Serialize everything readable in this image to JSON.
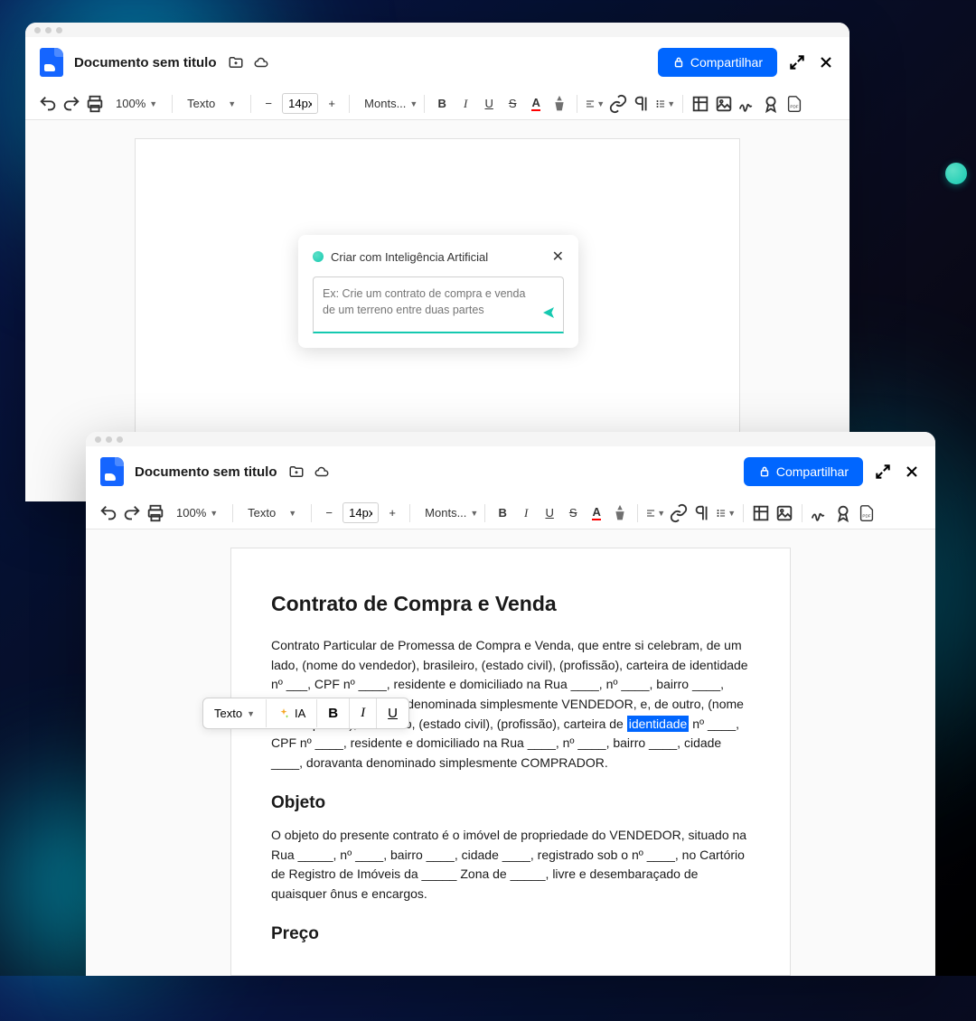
{
  "header": {
    "title": "Documento sem titulo",
    "share_label": "Compartilhar"
  },
  "toolbar": {
    "zoom": "100%",
    "style": "Texto",
    "font_size": "14px",
    "font_family": "Monts..."
  },
  "ai_dialog": {
    "title": "Criar com Inteligência Artificial",
    "placeholder": "Ex: Crie um contrato de compra e venda de um terreno entre duas partes"
  },
  "float_toolbar": {
    "style": "Texto",
    "ai_label": "IA"
  },
  "document": {
    "title": "Contrato de Compra e Venda",
    "para1_a": "Contrato Particular de Promessa de Compra e Venda, que entre si celebram, de um lado, (nome do vendedor), brasileiro, (estado civil), (profissão), carteira de identidade nº ___, CPF nº ____, residente e domiciliado na Rua ____, nº ____, bairro ____, cidade ____, doravante denominada simplesmente VENDEDOR, e, de outro, (nome do comprador), brasileiro, (estado civil), (profissão), carteira de ",
    "para1_hl": "identidade",
    "para1_b": " nº ____, CPF nº ____, residente e domiciliado na Rua ____, nº ____, bairro ____, cidade ____, doravanta denominado simplesmente COMPRADOR.",
    "h2_1": "Objeto",
    "para2": "O objeto do presente contrato é o imóvel de propriedade do VENDEDOR, situado na Rua _____, nº ____, bairro ____, cidade ____, registrado sob o nº ____, no Cartório de Registro de Imóveis da _____ Zona de _____, livre e desembaraçado de quaisquer ônus e encargos.",
    "h2_2": "Preço"
  }
}
